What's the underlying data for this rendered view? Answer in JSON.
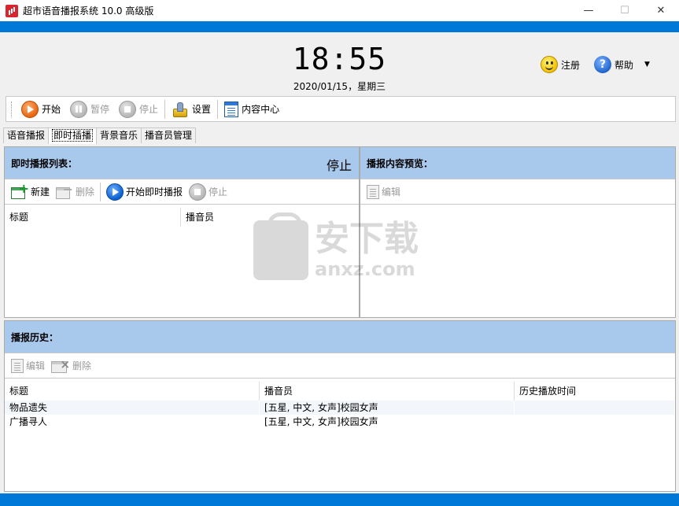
{
  "window": {
    "title": "超市语音播报系统 10.0 高级版",
    "minimize": "—",
    "maximize": "☐",
    "close": "✕"
  },
  "header": {
    "time": "18:55",
    "date": "2020/01/15，星期三",
    "register_label": "注册",
    "help_label": "帮助",
    "help_glyph": "?",
    "dropdown_glyph": "▼"
  },
  "toolbar": {
    "start_label": "开始",
    "pause_label": "暂停",
    "stop_label": "停止",
    "settings_label": "设置",
    "content_center_label": "内容中心"
  },
  "tabs": [
    {
      "label": "语音播报",
      "active": false
    },
    {
      "label": "即时插播",
      "active": true
    },
    {
      "label": "背景音乐",
      "active": false
    },
    {
      "label": "播音员管理",
      "active": false
    }
  ],
  "instant_panel": {
    "title": "即时播报列表：",
    "status": "停止",
    "new_label": "新建",
    "delete_label": "删除",
    "start_instant_label": "开始即时播报",
    "stop_label": "停止",
    "columns": [
      "标题",
      "播音员"
    ],
    "rows": []
  },
  "preview_panel": {
    "title": "播报内容预览：",
    "edit_label": "编辑"
  },
  "history_panel": {
    "title": "播报历史：",
    "edit_label": "编辑",
    "delete_label": "删除",
    "columns": [
      "标题",
      "播音员",
      "历史播放时间"
    ],
    "rows": [
      {
        "title": "物品遗失",
        "announcer": "[五星, 中文, 女声]校园女声",
        "time": ""
      },
      {
        "title": "广播寻人",
        "announcer": "[五星, 中文, 女声]校园女声",
        "time": ""
      }
    ]
  },
  "watermark": {
    "line1": "安下载",
    "line2": "anxz.com"
  },
  "colors": {
    "accent_blue": "#0078d7",
    "panel_header": "#a8c8ec"
  }
}
